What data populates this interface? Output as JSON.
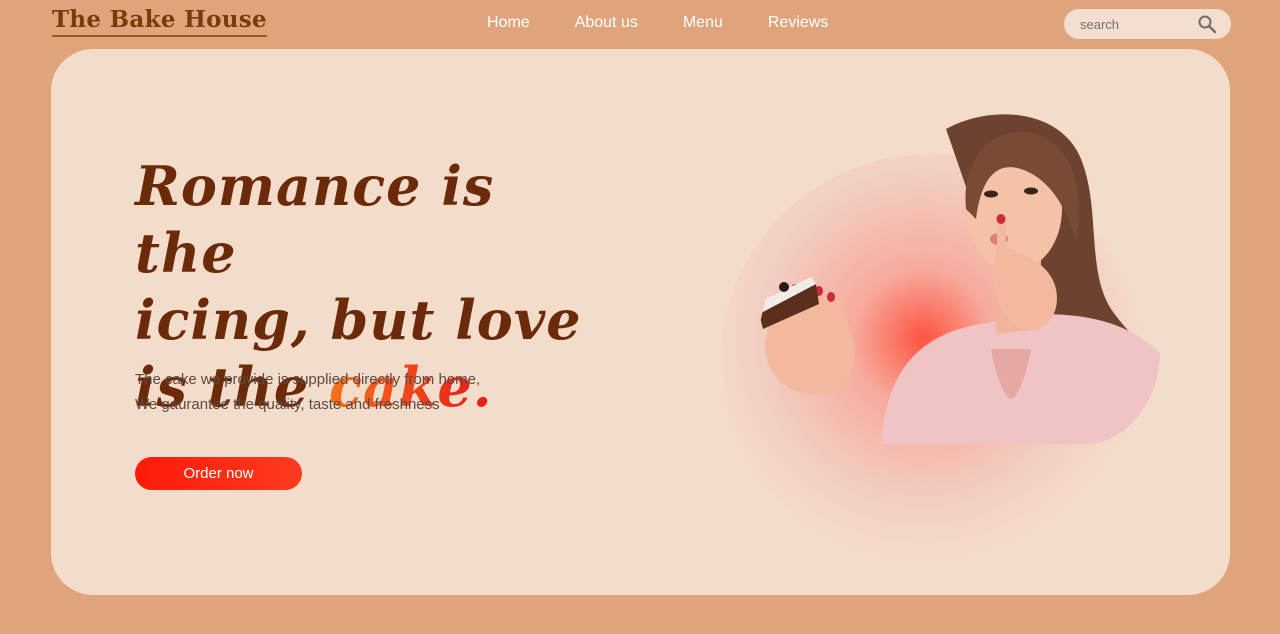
{
  "header": {
    "logo": "The Bake House",
    "nav": [
      "Home",
      "About us",
      "Menu",
      "Reviews"
    ],
    "search": {
      "placeholder": "search",
      "icon": "search-icon"
    }
  },
  "hero": {
    "headline_line1": "Romance is the",
    "headline_line2": "icing, but love",
    "headline_line3_prefix": "is the ",
    "headline_highlight": "cake",
    "headline_dot": ".",
    "subtext_line1": "The cake we provide is supplied directly from home,",
    "subtext_line2": "We gaurantee the quality, taste and freshness",
    "cta": "Order now"
  },
  "colors": {
    "page_bg": "#e0a47c",
    "card_bg": "#f4dccb",
    "headline": "#6b2a0a",
    "accent_orange": "#f7731b",
    "accent_red": "#e8221a",
    "button": "#ff1a0a"
  }
}
